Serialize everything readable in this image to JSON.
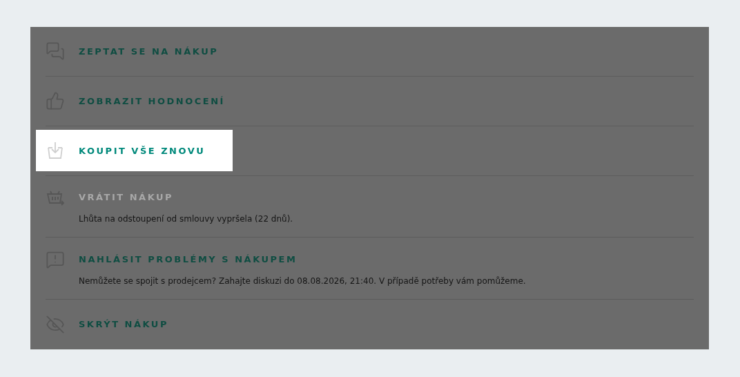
{
  "actions": [
    {
      "kind": "chat",
      "title": "ZEPTAT SE NA NÁKUP",
      "selected": false,
      "disabled": false
    },
    {
      "kind": "thumb",
      "title": "ZOBRAZIT HODNOCENÍ",
      "selected": false,
      "disabled": false
    },
    {
      "kind": "rebuy",
      "title": "KOUPIT VŠE ZNOVU",
      "selected": true,
      "disabled": false
    },
    {
      "kind": "return",
      "title": "VRÁTIT NÁKUP",
      "selected": false,
      "disabled": true,
      "description": "Lhůta na odstoupení od smlouvy vypršela (22 dnů)."
    },
    {
      "kind": "report",
      "title": "NAHLÁSIT PROBLÉMY S NÁKUPEM",
      "selected": false,
      "disabled": false,
      "description": "Nemůžete se spojit s prodejcem? Zahajte diskuzi do 08.08.2026, 21:40. V případě potřeby vám pomůžeme."
    },
    {
      "kind": "hide",
      "title": "SKRÝT NÁKUP",
      "selected": false,
      "disabled": false
    }
  ]
}
